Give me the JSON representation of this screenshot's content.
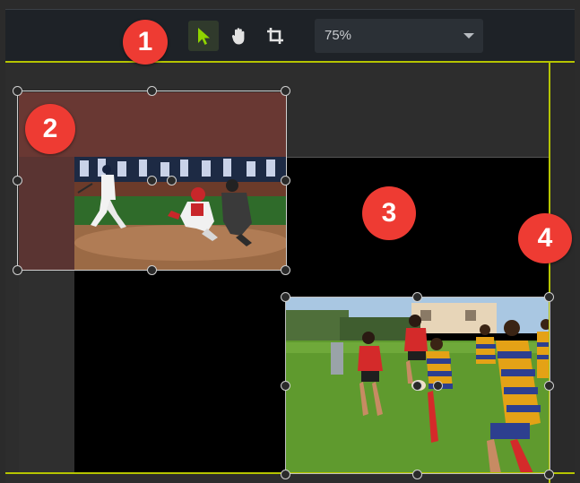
{
  "toolbar": {
    "zoom_value": "75%",
    "tools": [
      "select-tool",
      "hand-tool",
      "crop-tool"
    ],
    "active_tool": "select-tool"
  },
  "colors": {
    "accent_green": "#8fd400",
    "guide_line": "#b5c400",
    "callout_red": "#ee3b33",
    "canvas_background": "#000000",
    "toolbar_background": "#1e2227"
  },
  "callouts": [
    "1",
    "2",
    "3",
    "4"
  ],
  "canvas": {
    "clips": [
      {
        "name": "baseball-clip",
        "selected": true
      },
      {
        "name": "rugby-clip",
        "selected": true
      }
    ]
  }
}
